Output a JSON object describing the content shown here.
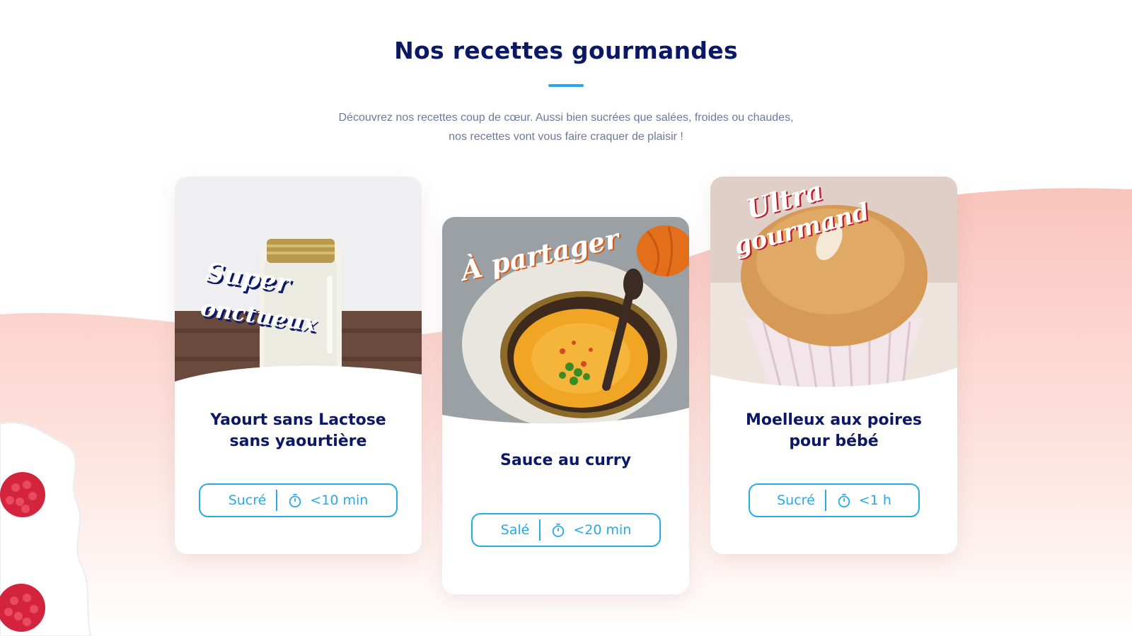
{
  "section": {
    "title": "Nos recettes gourmandes",
    "intro_line1": "Découvrez nos recettes coup de cœur. Aussi bien sucrées que salées, froides ou chaudes,",
    "intro_line2": "nos recettes vont vous faire craquer de plaisir !"
  },
  "colors": {
    "title": "#0b1866",
    "accent_blue": "#29a9e8",
    "intro_text": "#6b7a9a",
    "wave_pink": "#f9c9c2"
  },
  "recipes": [
    {
      "badge": "Super onctueux",
      "title": "Yaourt sans Lactose sans yaourtière",
      "type": "Sucré",
      "time": "<10 min",
      "timer_icon": "stopwatch-icon",
      "image": "yogurt-jar"
    },
    {
      "badge": "À partager",
      "title": "Sauce au curry",
      "type": "Salé",
      "time": "<20 min",
      "timer_icon": "stopwatch-icon",
      "image": "curry-bowl"
    },
    {
      "badge": "Ultra gourmand",
      "title": "Moelleux aux poires pour bébé",
      "type": "Sucré",
      "time": "<1 h",
      "timer_icon": "stopwatch-icon",
      "image": "muffin"
    }
  ]
}
